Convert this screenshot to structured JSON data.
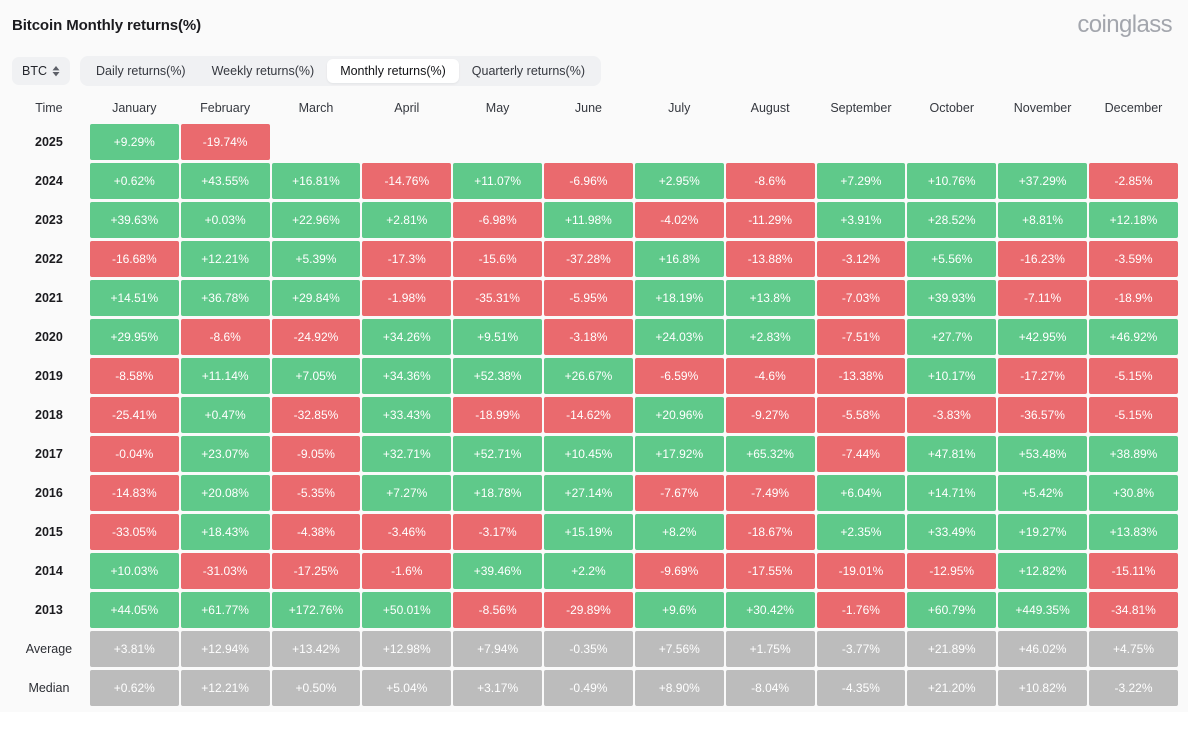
{
  "header": {
    "title": "Bitcoin Monthly returns(%)",
    "brand": "coinglass"
  },
  "toolbar": {
    "symbol": "BTC",
    "symbol_icon": "chevron-up-down-icon",
    "tabs": [
      {
        "label": "Daily returns(%)",
        "active": false
      },
      {
        "label": "Weekly returns(%)",
        "active": false
      },
      {
        "label": "Monthly returns(%)",
        "active": true
      },
      {
        "label": "Quarterly returns(%)",
        "active": false
      }
    ]
  },
  "colors": {
    "positive": "#5fc98a",
    "negative": "#ea6a6e",
    "neutral": "#bcbcbc",
    "page_background": "#fafafa",
    "brand_text": "#a3a6ad"
  },
  "chart_data": {
    "type": "heatmap",
    "title": "Bitcoin Monthly returns(%)",
    "xlabel": "",
    "ylabel": "Time",
    "legend": "green = positive return, red = negative return, grey = summary statistic",
    "columns": [
      "Time",
      "January",
      "February",
      "March",
      "April",
      "May",
      "June",
      "July",
      "August",
      "September",
      "October",
      "November",
      "December"
    ],
    "categories": [
      "January",
      "February",
      "March",
      "April",
      "May",
      "June",
      "July",
      "August",
      "September",
      "October",
      "November",
      "December"
    ],
    "rows": [
      {
        "label": "2025",
        "kind": "year",
        "values": [
          "+9.29%",
          "-19.74%",
          "",
          "",
          "",
          "",
          "",
          "",
          "",
          "",
          "",
          ""
        ]
      },
      {
        "label": "2024",
        "kind": "year",
        "values": [
          "+0.62%",
          "+43.55%",
          "+16.81%",
          "-14.76%",
          "+11.07%",
          "-6.96%",
          "+2.95%",
          "-8.6%",
          "+7.29%",
          "+10.76%",
          "+37.29%",
          "-2.85%"
        ]
      },
      {
        "label": "2023",
        "kind": "year",
        "values": [
          "+39.63%",
          "+0.03%",
          "+22.96%",
          "+2.81%",
          "-6.98%",
          "+11.98%",
          "-4.02%",
          "-11.29%",
          "+3.91%",
          "+28.52%",
          "+8.81%",
          "+12.18%"
        ]
      },
      {
        "label": "2022",
        "kind": "year",
        "values": [
          "-16.68%",
          "+12.21%",
          "+5.39%",
          "-17.3%",
          "-15.6%",
          "-37.28%",
          "+16.8%",
          "-13.88%",
          "-3.12%",
          "+5.56%",
          "-16.23%",
          "-3.59%"
        ]
      },
      {
        "label": "2021",
        "kind": "year",
        "values": [
          "+14.51%",
          "+36.78%",
          "+29.84%",
          "-1.98%",
          "-35.31%",
          "-5.95%",
          "+18.19%",
          "+13.8%",
          "-7.03%",
          "+39.93%",
          "-7.11%",
          "-18.9%"
        ]
      },
      {
        "label": "2020",
        "kind": "year",
        "values": [
          "+29.95%",
          "-8.6%",
          "-24.92%",
          "+34.26%",
          "+9.51%",
          "-3.18%",
          "+24.03%",
          "+2.83%",
          "-7.51%",
          "+27.7%",
          "+42.95%",
          "+46.92%"
        ]
      },
      {
        "label": "2019",
        "kind": "year",
        "values": [
          "-8.58%",
          "+11.14%",
          "+7.05%",
          "+34.36%",
          "+52.38%",
          "+26.67%",
          "-6.59%",
          "-4.6%",
          "-13.38%",
          "+10.17%",
          "-17.27%",
          "-5.15%"
        ]
      },
      {
        "label": "2018",
        "kind": "year",
        "values": [
          "-25.41%",
          "+0.47%",
          "-32.85%",
          "+33.43%",
          "-18.99%",
          "-14.62%",
          "+20.96%",
          "-9.27%",
          "-5.58%",
          "-3.83%",
          "-36.57%",
          "-5.15%"
        ]
      },
      {
        "label": "2017",
        "kind": "year",
        "values": [
          "-0.04%",
          "+23.07%",
          "-9.05%",
          "+32.71%",
          "+52.71%",
          "+10.45%",
          "+17.92%",
          "+65.32%",
          "-7.44%",
          "+47.81%",
          "+53.48%",
          "+38.89%"
        ]
      },
      {
        "label": "2016",
        "kind": "year",
        "values": [
          "-14.83%",
          "+20.08%",
          "-5.35%",
          "+7.27%",
          "+18.78%",
          "+27.14%",
          "-7.67%",
          "-7.49%",
          "+6.04%",
          "+14.71%",
          "+5.42%",
          "+30.8%"
        ]
      },
      {
        "label": "2015",
        "kind": "year",
        "values": [
          "-33.05%",
          "+18.43%",
          "-4.38%",
          "-3.46%",
          "-3.17%",
          "+15.19%",
          "+8.2%",
          "-18.67%",
          "+2.35%",
          "+33.49%",
          "+19.27%",
          "+13.83%"
        ]
      },
      {
        "label": "2014",
        "kind": "year",
        "values": [
          "+10.03%",
          "-31.03%",
          "-17.25%",
          "-1.6%",
          "+39.46%",
          "+2.2%",
          "-9.69%",
          "-17.55%",
          "-19.01%",
          "-12.95%",
          "+12.82%",
          "-15.11%"
        ]
      },
      {
        "label": "2013",
        "kind": "year",
        "values": [
          "+44.05%",
          "+61.77%",
          "+172.76%",
          "+50.01%",
          "-8.56%",
          "-29.89%",
          "+9.6%",
          "+30.42%",
          "-1.76%",
          "+60.79%",
          "+449.35%",
          "-34.81%"
        ]
      },
      {
        "label": "Average",
        "kind": "stat",
        "values": [
          "+3.81%",
          "+12.94%",
          "+13.42%",
          "+12.98%",
          "+7.94%",
          "-0.35%",
          "+7.56%",
          "+1.75%",
          "-3.77%",
          "+21.89%",
          "+46.02%",
          "+4.75%"
        ]
      },
      {
        "label": "Median",
        "kind": "stat",
        "values": [
          "+0.62%",
          "+12.21%",
          "+0.50%",
          "+5.04%",
          "+3.17%",
          "-0.49%",
          "+8.90%",
          "-8.04%",
          "-4.35%",
          "+21.20%",
          "+10.82%",
          "-3.22%"
        ]
      }
    ]
  }
}
